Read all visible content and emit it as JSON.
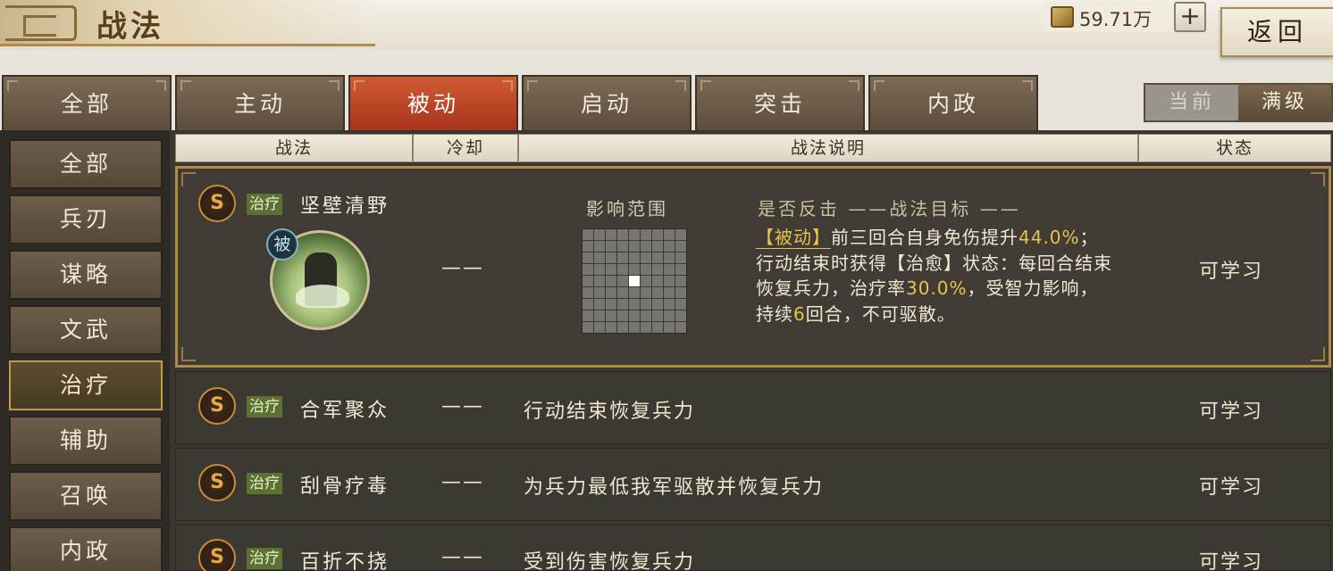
{
  "header": {
    "title": "战法",
    "currency": "59.71万",
    "plus_label": "+",
    "back_label": "返回"
  },
  "tabs": [
    "全部",
    "主动",
    "被动",
    "启动",
    "突击",
    "内政"
  ],
  "active_tab": "被动",
  "level_toggle": {
    "current_label": "当前",
    "max_label": "满级",
    "selected": "满级"
  },
  "sidebar": {
    "items": [
      "全部",
      "兵刃",
      "谋略",
      "文武",
      "治疗",
      "辅助",
      "召唤",
      "内政"
    ],
    "active": "治疗"
  },
  "columns": {
    "skill": "战法",
    "cooldown": "冷却",
    "description": "战法说明",
    "status": "状态"
  },
  "expanded": {
    "grade": "S",
    "tag": "治疗",
    "name": "坚壁清野",
    "passive_mark": "被",
    "cooldown": "——",
    "range_label": "影响范围",
    "target_label": "是否反击 ——战法目标 ——",
    "desc_p1": "【被动】",
    "desc_p2": "前三回合自身免伤提升",
    "desc_p3": "44.0%",
    "desc_p4": "；行动结束时获得【治愈】状态：每回合结束恢复兵力，治疗率",
    "desc_p5": "30.0%",
    "desc_p6": "，受智力影响，持续",
    "desc_p7": "6",
    "desc_p8": "回合，不可驱散。",
    "status": "可学习"
  },
  "rows": [
    {
      "grade": "S",
      "tag": "治疗",
      "name": "合军聚众",
      "cooldown": "——",
      "description": "行动结束恢复兵力",
      "status": "可学习"
    },
    {
      "grade": "S",
      "tag": "治疗",
      "name": "刮骨疗毒",
      "cooldown": "——",
      "description": "为兵力最低我军驱散并恢复兵力",
      "status": "可学习"
    },
    {
      "grade": "S",
      "tag": "治疗",
      "name": "百折不挠",
      "cooldown": "——",
      "description": "受到伤害恢复兵力",
      "status": "可学习"
    }
  ],
  "colors": {
    "active_tab": "#b8401f",
    "highlight": "#e8c34a",
    "tag_bg": "#5c7034"
  }
}
